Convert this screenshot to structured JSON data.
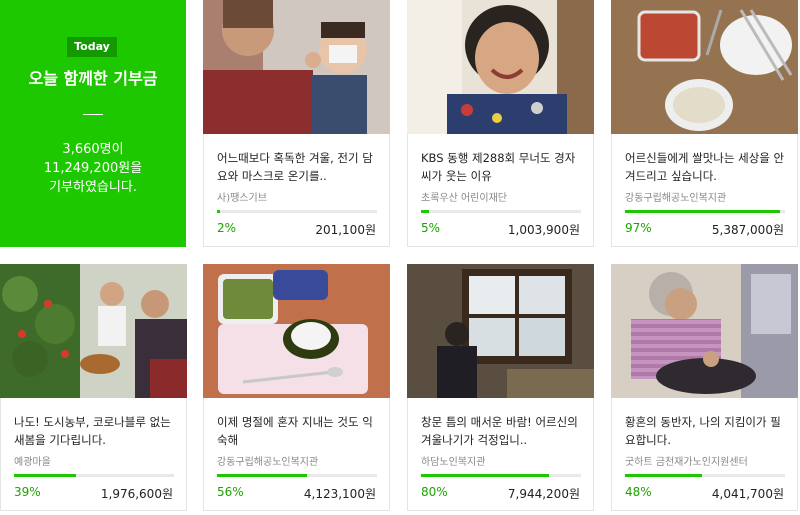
{
  "summary": {
    "badge": "Today",
    "title": "오늘 함께한 기부금",
    "donors": "3,660명이",
    "total": "11,249,200원을",
    "suffix": "기부하였습니다."
  },
  "cards": [
    {
      "title": "어느때보다 혹독한 겨울, 전기 담요와 마스크로 온기를..",
      "org": "사)땡스기브",
      "percent": "2%",
      "progress": 0.02,
      "amount": "201,100원"
    },
    {
      "title": "KBS 동행 제288회 무너도 경자씨가 웃는 이유",
      "org": "초록우산 어린이재단",
      "percent": "5%",
      "progress": 0.05,
      "amount": "1,003,900원"
    },
    {
      "title": "어르신들에게 쌀맛나는 세상을 안겨드리고 싶습니다.",
      "org": "강동구립해공노인복지관",
      "percent": "97%",
      "progress": 0.97,
      "amount": "5,387,000원"
    },
    {
      "title": "나도! 도시농부, 코로나블루 없는 새봄을 기다립니다.",
      "org": "예광마을",
      "percent": "39%",
      "progress": 0.39,
      "amount": "1,976,600원"
    },
    {
      "title": "이제 명절에 혼자 지내는 것도 익숙해",
      "org": "강동구립해공노인복지관",
      "percent": "56%",
      "progress": 0.56,
      "amount": "4,123,100원"
    },
    {
      "title": "창문 틈의 매서운 바람! 어르신의 겨울나기가 걱정입니..",
      "org": "하담노인복지관",
      "percent": "80%",
      "progress": 0.8,
      "amount": "7,944,200원"
    },
    {
      "title": "황혼의 동반자, 나의 지킴이가 필요합니다.",
      "org": "굿하트 금천재가노인지원센터",
      "percent": "48%",
      "progress": 0.48,
      "amount": "4,041,700원"
    }
  ],
  "colors": {
    "accent": "#1ec800",
    "badge": "#129a00",
    "percent_text": "#1ea300"
  }
}
